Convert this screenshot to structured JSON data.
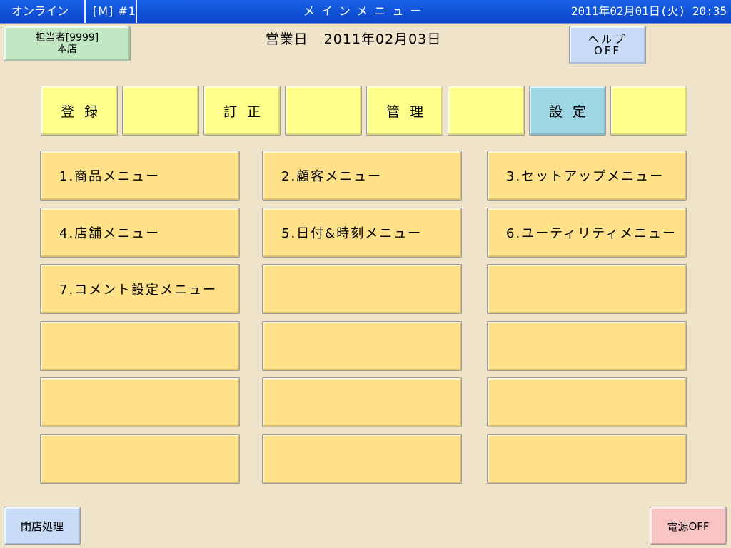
{
  "status_bar": {
    "connection": "オンライン",
    "mode": "[M]  #1",
    "title": "メインメニュー",
    "datetime": "2011年02月01日(火) 20:35"
  },
  "operator": {
    "line1": "担当者[9999]",
    "line2": "本店"
  },
  "business_date": {
    "label": "営業日",
    "value": "2011年02月03日"
  },
  "help": {
    "line1": "ヘルプ",
    "line2": "OFF"
  },
  "tabs": [
    {
      "label": "登録"
    },
    {
      "label": ""
    },
    {
      "label": "訂正"
    },
    {
      "label": ""
    },
    {
      "label": "管理"
    },
    {
      "label": ""
    },
    {
      "label": "設定",
      "selected": true
    },
    {
      "label": ""
    }
  ],
  "menu": [
    [
      "1.商品メニュー",
      "2.顧客メニュー",
      "3.セットアップメニュー"
    ],
    [
      "4.店舗メニュー",
      "5.日付&時刻メニュー",
      "6.ユーティリティメニュー"
    ],
    [
      "7.コメント設定メニュー",
      "",
      ""
    ],
    [
      "",
      "",
      ""
    ],
    [
      "",
      "",
      ""
    ],
    [
      "",
      "",
      ""
    ]
  ],
  "footer": {
    "close_store": "閉店処理",
    "power_off": "電源OFF"
  },
  "colors": {
    "background": "#efe3c9",
    "status_bar": "#0a46c8",
    "tab": "#ffff8c",
    "tab_selected": "#9fd7e4",
    "menu_button": "#ffe18a",
    "operator_button": "#c2e7c3",
    "help_button": "#c9dcf7",
    "power_button": "#f8c4c4"
  }
}
